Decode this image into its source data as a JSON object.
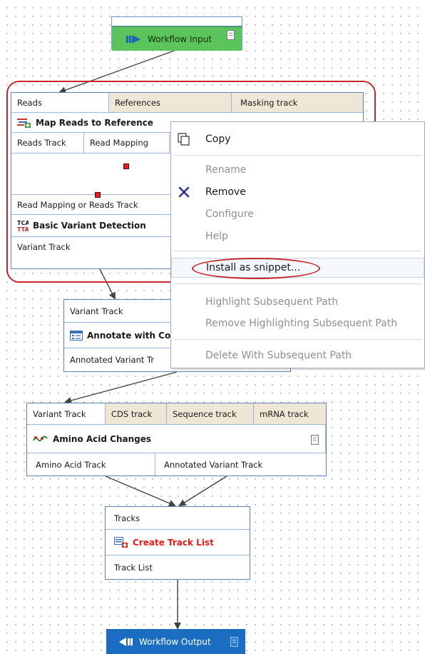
{
  "workflow_input": {
    "label": "Workflow Input"
  },
  "workflow_output": {
    "label": "Workflow Output"
  },
  "map_reads": {
    "inputs": [
      "Reads",
      "References",
      "Masking track"
    ],
    "title": "Map Reads to Reference",
    "outputs": [
      "Reads Track",
      "Read Mapping"
    ]
  },
  "variant_detection": {
    "input": "Read Mapping or Reads Track",
    "title": "Basic Variant Detection",
    "title_icon_text": "TCA\nTTA",
    "output": "Variant Track"
  },
  "annotate": {
    "input": "Variant Track",
    "title": "Annotate with Co",
    "output": "Annotated Variant Tr"
  },
  "amino": {
    "inputs": [
      "Variant Track",
      "CDS track",
      "Sequence track",
      "mRNA track"
    ],
    "title": "Amino Acid Changes",
    "outputs": [
      "Amino Acid Track",
      "Annotated Variant Track"
    ]
  },
  "track_list": {
    "input": "Tracks",
    "title": "Create Track List",
    "output": "Track List"
  },
  "context_menu": {
    "items": [
      {
        "label": "Copy",
        "enabled": true,
        "icon": "copy-icon"
      },
      {
        "label": "Rename",
        "enabled": false
      },
      {
        "label": "Remove",
        "enabled": true,
        "icon": "remove-x-icon"
      },
      {
        "label": "Configure",
        "enabled": false
      },
      {
        "label": "Help",
        "enabled": false
      },
      {
        "label": "Install as snippet...",
        "enabled": true,
        "highlighted": true
      },
      {
        "label": "Highlight Subsequent Path",
        "enabled": false
      },
      {
        "label": "Remove Highlighting Subsequent Path",
        "enabled": false
      },
      {
        "label": "Delete With Subsequent Path",
        "enabled": false
      }
    ]
  },
  "colors": {
    "input_green": "#5bc45b",
    "output_blue": "#1b6dc1",
    "annotation_red": "#c5272c",
    "beige_port": "#efe6d6"
  }
}
